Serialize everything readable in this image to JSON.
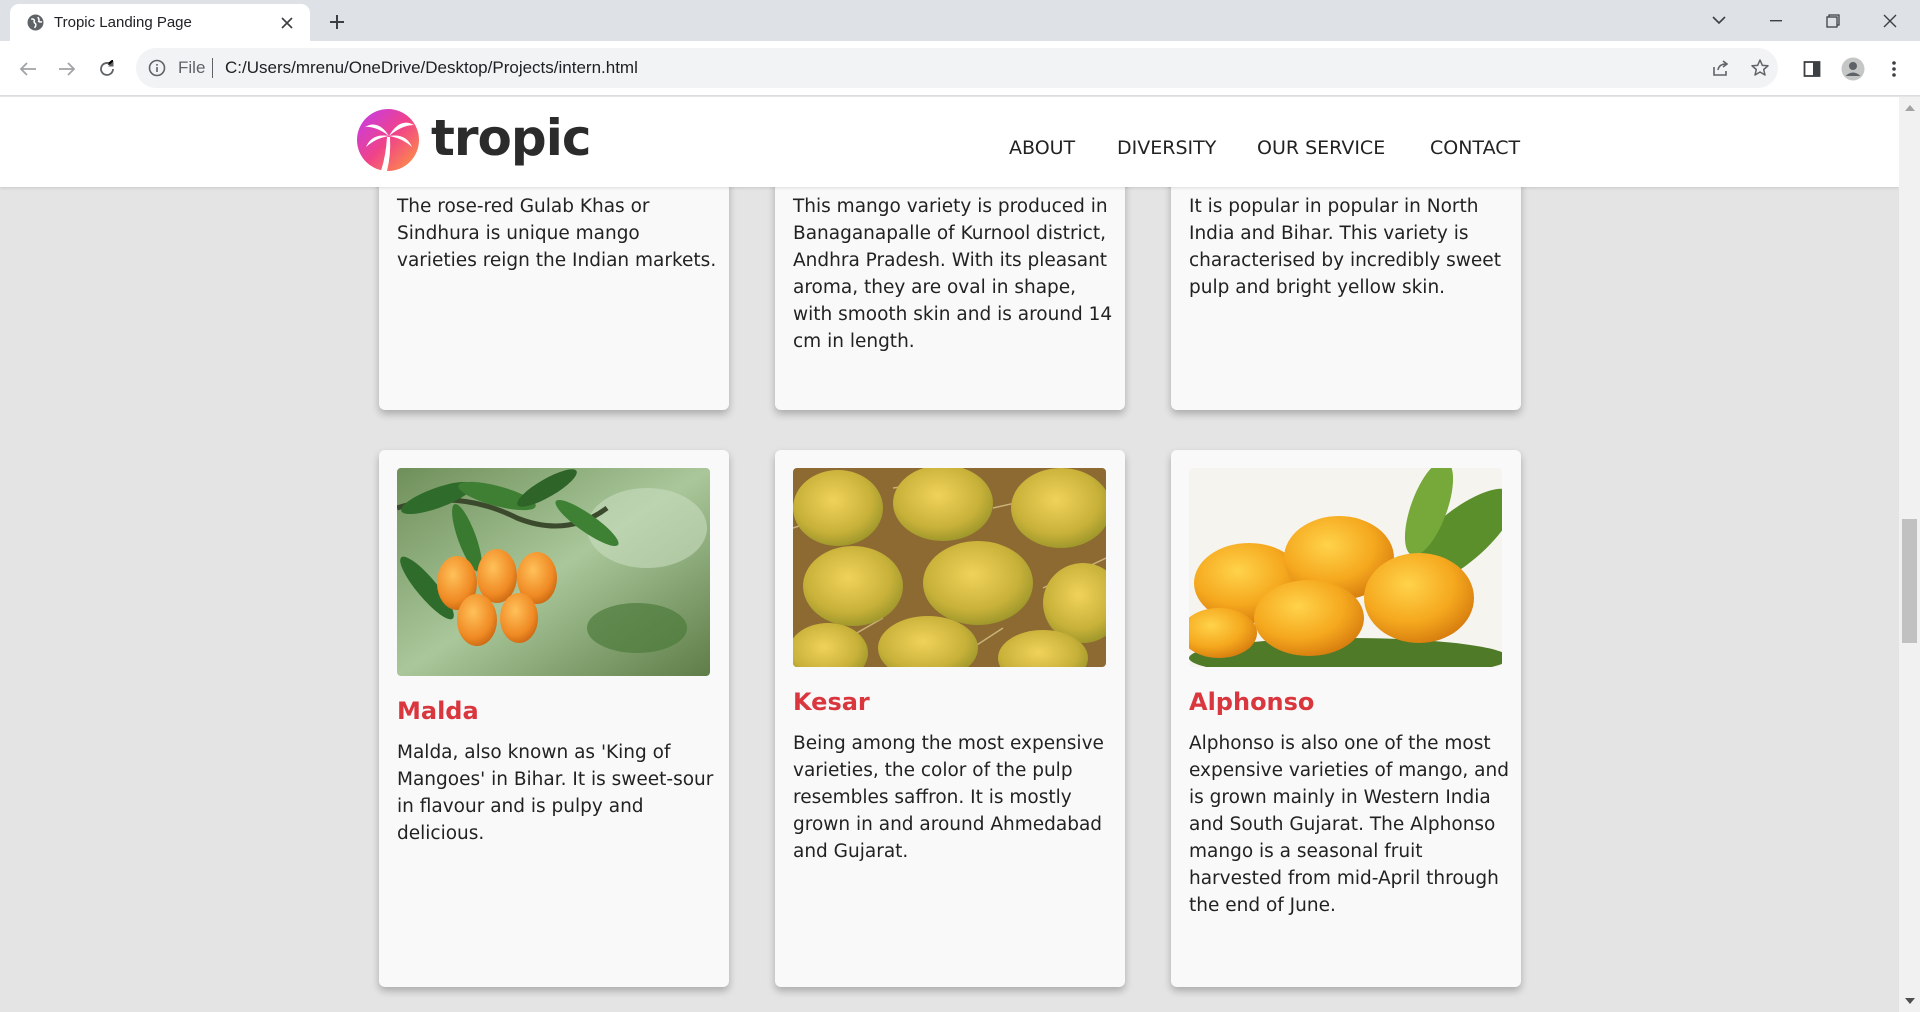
{
  "browser": {
    "tab_title": "Tropic Landing Page",
    "omnibox_scheme": "File",
    "url": "C:/Users/mrenu/OneDrive/Desktop/Projects/intern.html"
  },
  "header": {
    "logo_text": "tropic",
    "nav": [
      "ABOUT",
      "DIVERSITY",
      "OUR SERVICE",
      "CONTACT"
    ]
  },
  "cards_top": [
    {
      "description": "The rose-red Gulab Khas or Sindhura is unique mango varieties reign the Indian markets."
    },
    {
      "description": "This mango variety is produced in Banaganapalle of Kurnool district, Andhra Pradesh. With its pleasant aroma, they are oval in shape, with smooth skin and is around 14 cm in length."
    },
    {
      "description": "It is popular in popular in North India and Bihar. This variety is characterised by incredibly sweet pulp and bright yellow skin."
    }
  ],
  "cards_bottom": [
    {
      "title": "Malda",
      "description": "Malda, also known as 'King of Mangoes' in Bihar. It is sweet-sour in flavour and is pulpy and delicious."
    },
    {
      "title": "Kesar",
      "description": "Being among the most expensive varieties, the color of the pulp resembles saffron. It is mostly grown in and around Ahmedabad and Gujarat."
    },
    {
      "title": "Alphonso",
      "description": "Alphonso is also one of the most expensive varieties of mango, and is grown mainly in Western India and South Gujarat. The Alphonso mango is a seasonal fruit harvested from mid-April through the end of June."
    }
  ],
  "colors": {
    "accent": "#d9363e",
    "page_bg": "#e4e4e4",
    "card_bg": "#f9f9f9"
  }
}
